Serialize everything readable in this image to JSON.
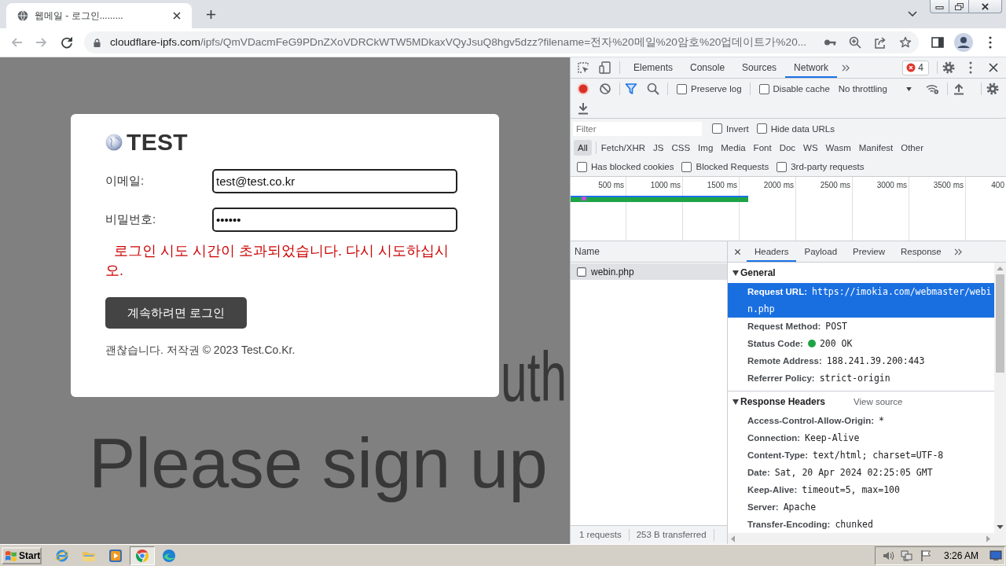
{
  "browser": {
    "tabs": [
      {
        "title": "웹메일 - 로그인.........",
        "selected": true
      }
    ],
    "back": {
      "disabled": true
    },
    "forward": {
      "disabled": true
    },
    "url_host": "cloudflare-ipfs.com",
    "url_rest": "/ipfs/QmVDacmFeG9PDnZXoVDRCkWTW5MDkaxVQyJsuQ8hgv5dzz?filename=전자%20메일%20암호%20업데이트가%20..."
  },
  "page": {
    "backdrop_text": [
      "uth",
      "Please sign up"
    ],
    "logo": "TEST",
    "fields": [
      {
        "label": "이메일:",
        "value": "test@test.co.kr"
      },
      {
        "label": "비밀번호:",
        "value": "••••••"
      }
    ],
    "error": "로그인 시도 시간이 초과되었습니다. 다시 시도하십시오.",
    "button": "계속하려면 로그인",
    "footer": "괜찮습니다. 저작권 © 2023 Test.Co.Kr."
  },
  "devtools": {
    "tabs": [
      {
        "label": "Elements",
        "selected": false
      },
      {
        "label": "Console",
        "selected": false
      },
      {
        "label": "Sources",
        "selected": false
      },
      {
        "label": "Network",
        "selected": true
      }
    ],
    "error_count": "4",
    "recording": true,
    "options": [
      {
        "label": "Preserve log",
        "checked": false
      },
      {
        "label": "Disable cache",
        "checked": false
      }
    ],
    "throttling": "No throttling",
    "filter": {
      "placeholder": "Filter"
    },
    "filter_options": [
      {
        "label": "Invert",
        "checked": false
      },
      {
        "label": "Hide data URLs",
        "checked": false
      }
    ],
    "types": [
      {
        "label": "All",
        "selected": true
      },
      {
        "label": "Fetch/XHR",
        "selected": false
      },
      {
        "label": "JS",
        "selected": false
      },
      {
        "label": "CSS",
        "selected": false
      },
      {
        "label": "Img",
        "selected": false
      },
      {
        "label": "Media",
        "selected": false
      },
      {
        "label": "Font",
        "selected": false
      },
      {
        "label": "Doc",
        "selected": false
      },
      {
        "label": "WS",
        "selected": false
      },
      {
        "label": "Wasm",
        "selected": false
      },
      {
        "label": "Manifest",
        "selected": false
      },
      {
        "label": "Other",
        "selected": false
      }
    ],
    "blocked_options": [
      {
        "label": "Has blocked cookies",
        "checked": false
      },
      {
        "label": "Blocked Requests",
        "checked": false
      },
      {
        "label": "3rd-party requests",
        "checked": false
      }
    ],
    "timeline_ticks": [
      "500 ms",
      "1000 ms",
      "1500 ms",
      "2000 ms",
      "2500 ms",
      "3000 ms",
      "3500 ms",
      "400"
    ],
    "requests": {
      "column": "Name",
      "rows": [
        {
          "name": "webin.php",
          "selected": true
        }
      ],
      "summary": [
        "1 requests",
        "253 B transferred"
      ]
    },
    "detail_tabs": [
      {
        "label": "Headers",
        "selected": true
      },
      {
        "label": "Payload",
        "selected": false
      },
      {
        "label": "Preview",
        "selected": false
      },
      {
        "label": "Response",
        "selected": false
      }
    ],
    "sections": [
      {
        "title": "General",
        "expanded": true,
        "rows": [
          {
            "key": "Request URL:",
            "value": "https://imokia.com/webmaster/webin.php",
            "selected": true
          },
          {
            "key": "Request Method:",
            "value": "POST",
            "selected": false
          },
          {
            "key": "Status Code:",
            "value": "200 OK",
            "selected": false,
            "color": "#1ea446"
          },
          {
            "key": "Remote Address:",
            "value": "188.241.39.200:443",
            "selected": false
          },
          {
            "key": "Referrer Policy:",
            "value": "strict-origin",
            "selected": false
          }
        ]
      },
      {
        "title": "Response Headers",
        "expanded": true,
        "link": "View source",
        "rows": [
          {
            "key": "Access-Control-Allow-Origin:",
            "value": "*",
            "selected": false
          },
          {
            "key": "Connection:",
            "value": "Keep-Alive",
            "selected": false
          },
          {
            "key": "Content-Type:",
            "value": "text/html; charset=UTF-8",
            "selected": false
          },
          {
            "key": "Date:",
            "value": "Sat, 20 Apr 2024 02:25:05 GMT",
            "selected": false
          },
          {
            "key": "Keep-Alive:",
            "value": "timeout=5, max=100",
            "selected": false
          },
          {
            "key": "Server:",
            "value": "Apache",
            "selected": false
          },
          {
            "key": "Transfer-Encoding:",
            "value": "chunked",
            "selected": false
          }
        ]
      }
    ]
  },
  "taskbar": {
    "start": "Start",
    "apps": [
      {
        "kind": "ring-e",
        "selected": false
      },
      {
        "kind": "folder",
        "selected": false
      },
      {
        "kind": "player",
        "selected": false
      },
      {
        "kind": "round",
        "selected": true
      },
      {
        "kind": "wave",
        "selected": false
      }
    ],
    "clock": "3:26 AM"
  }
}
